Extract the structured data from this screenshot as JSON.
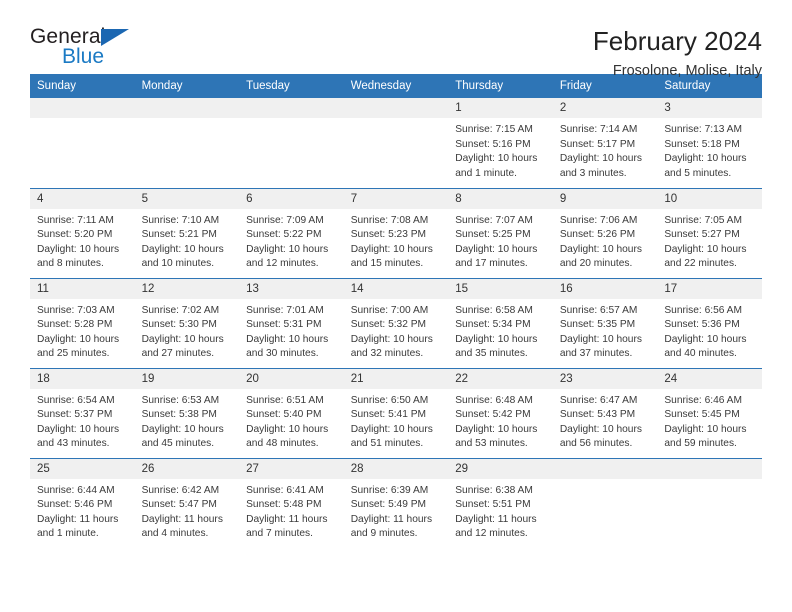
{
  "logo": {
    "word1": "General",
    "word2": "Blue",
    "triangle_color": "#1B67B2",
    "blue_color": "#1B7AC4"
  },
  "header": {
    "title": "February 2024",
    "subtitle": "Frosolone, Molise, Italy"
  },
  "theme": {
    "header_blue": "#2E75B6",
    "stripe_gray": "#f0f0f0"
  },
  "weekdays": [
    "Sunday",
    "Monday",
    "Tuesday",
    "Wednesday",
    "Thursday",
    "Friday",
    "Saturday"
  ],
  "labels": {
    "sunrise": "Sunrise:",
    "sunset": "Sunset:",
    "daylight": "Daylight:"
  },
  "weeks": [
    [
      {
        "day": ""
      },
      {
        "day": ""
      },
      {
        "day": ""
      },
      {
        "day": ""
      },
      {
        "day": "1",
        "sunrise": "Sunrise: 7:15 AM",
        "sunset": "Sunset: 5:16 PM",
        "daylight": "Daylight: 10 hours and 1 minute."
      },
      {
        "day": "2",
        "sunrise": "Sunrise: 7:14 AM",
        "sunset": "Sunset: 5:17 PM",
        "daylight": "Daylight: 10 hours and 3 minutes."
      },
      {
        "day": "3",
        "sunrise": "Sunrise: 7:13 AM",
        "sunset": "Sunset: 5:18 PM",
        "daylight": "Daylight: 10 hours and 5 minutes."
      }
    ],
    [
      {
        "day": "4",
        "sunrise": "Sunrise: 7:11 AM",
        "sunset": "Sunset: 5:20 PM",
        "daylight": "Daylight: 10 hours and 8 minutes."
      },
      {
        "day": "5",
        "sunrise": "Sunrise: 7:10 AM",
        "sunset": "Sunset: 5:21 PM",
        "daylight": "Daylight: 10 hours and 10 minutes."
      },
      {
        "day": "6",
        "sunrise": "Sunrise: 7:09 AM",
        "sunset": "Sunset: 5:22 PM",
        "daylight": "Daylight: 10 hours and 12 minutes."
      },
      {
        "day": "7",
        "sunrise": "Sunrise: 7:08 AM",
        "sunset": "Sunset: 5:23 PM",
        "daylight": "Daylight: 10 hours and 15 minutes."
      },
      {
        "day": "8",
        "sunrise": "Sunrise: 7:07 AM",
        "sunset": "Sunset: 5:25 PM",
        "daylight": "Daylight: 10 hours and 17 minutes."
      },
      {
        "day": "9",
        "sunrise": "Sunrise: 7:06 AM",
        "sunset": "Sunset: 5:26 PM",
        "daylight": "Daylight: 10 hours and 20 minutes."
      },
      {
        "day": "10",
        "sunrise": "Sunrise: 7:05 AM",
        "sunset": "Sunset: 5:27 PM",
        "daylight": "Daylight: 10 hours and 22 minutes."
      }
    ],
    [
      {
        "day": "11",
        "sunrise": "Sunrise: 7:03 AM",
        "sunset": "Sunset: 5:28 PM",
        "daylight": "Daylight: 10 hours and 25 minutes."
      },
      {
        "day": "12",
        "sunrise": "Sunrise: 7:02 AM",
        "sunset": "Sunset: 5:30 PM",
        "daylight": "Daylight: 10 hours and 27 minutes."
      },
      {
        "day": "13",
        "sunrise": "Sunrise: 7:01 AM",
        "sunset": "Sunset: 5:31 PM",
        "daylight": "Daylight: 10 hours and 30 minutes."
      },
      {
        "day": "14",
        "sunrise": "Sunrise: 7:00 AM",
        "sunset": "Sunset: 5:32 PM",
        "daylight": "Daylight: 10 hours and 32 minutes."
      },
      {
        "day": "15",
        "sunrise": "Sunrise: 6:58 AM",
        "sunset": "Sunset: 5:34 PM",
        "daylight": "Daylight: 10 hours and 35 minutes."
      },
      {
        "day": "16",
        "sunrise": "Sunrise: 6:57 AM",
        "sunset": "Sunset: 5:35 PM",
        "daylight": "Daylight: 10 hours and 37 minutes."
      },
      {
        "day": "17",
        "sunrise": "Sunrise: 6:56 AM",
        "sunset": "Sunset: 5:36 PM",
        "daylight": "Daylight: 10 hours and 40 minutes."
      }
    ],
    [
      {
        "day": "18",
        "sunrise": "Sunrise: 6:54 AM",
        "sunset": "Sunset: 5:37 PM",
        "daylight": "Daylight: 10 hours and 43 minutes."
      },
      {
        "day": "19",
        "sunrise": "Sunrise: 6:53 AM",
        "sunset": "Sunset: 5:38 PM",
        "daylight": "Daylight: 10 hours and 45 minutes."
      },
      {
        "day": "20",
        "sunrise": "Sunrise: 6:51 AM",
        "sunset": "Sunset: 5:40 PM",
        "daylight": "Daylight: 10 hours and 48 minutes."
      },
      {
        "day": "21",
        "sunrise": "Sunrise: 6:50 AM",
        "sunset": "Sunset: 5:41 PM",
        "daylight": "Daylight: 10 hours and 51 minutes."
      },
      {
        "day": "22",
        "sunrise": "Sunrise: 6:48 AM",
        "sunset": "Sunset: 5:42 PM",
        "daylight": "Daylight: 10 hours and 53 minutes."
      },
      {
        "day": "23",
        "sunrise": "Sunrise: 6:47 AM",
        "sunset": "Sunset: 5:43 PM",
        "daylight": "Daylight: 10 hours and 56 minutes."
      },
      {
        "day": "24",
        "sunrise": "Sunrise: 6:46 AM",
        "sunset": "Sunset: 5:45 PM",
        "daylight": "Daylight: 10 hours and 59 minutes."
      }
    ],
    [
      {
        "day": "25",
        "sunrise": "Sunrise: 6:44 AM",
        "sunset": "Sunset: 5:46 PM",
        "daylight": "Daylight: 11 hours and 1 minute."
      },
      {
        "day": "26",
        "sunrise": "Sunrise: 6:42 AM",
        "sunset": "Sunset: 5:47 PM",
        "daylight": "Daylight: 11 hours and 4 minutes."
      },
      {
        "day": "27",
        "sunrise": "Sunrise: 6:41 AM",
        "sunset": "Sunset: 5:48 PM",
        "daylight": "Daylight: 11 hours and 7 minutes."
      },
      {
        "day": "28",
        "sunrise": "Sunrise: 6:39 AM",
        "sunset": "Sunset: 5:49 PM",
        "daylight": "Daylight: 11 hours and 9 minutes."
      },
      {
        "day": "29",
        "sunrise": "Sunrise: 6:38 AM",
        "sunset": "Sunset: 5:51 PM",
        "daylight": "Daylight: 11 hours and 12 minutes."
      },
      {
        "day": ""
      },
      {
        "day": ""
      }
    ]
  ]
}
